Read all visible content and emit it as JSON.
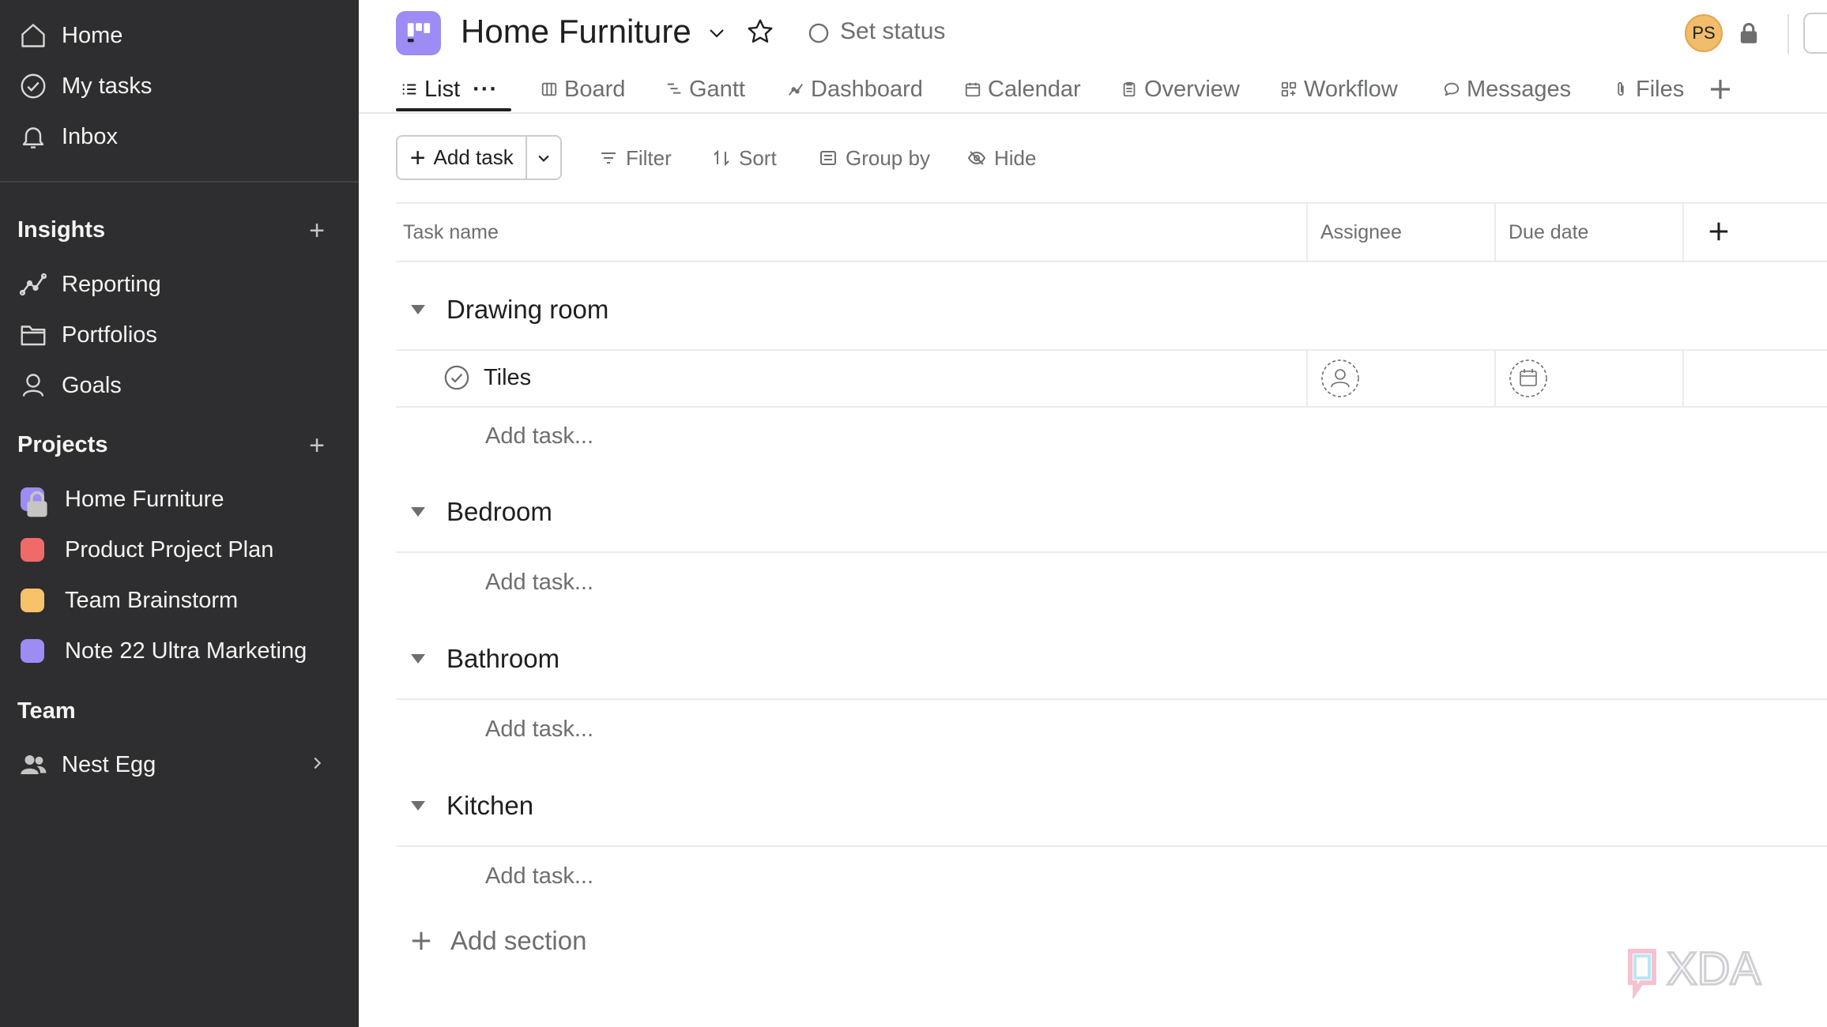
{
  "sidebar": {
    "nav": [
      {
        "label": "Home",
        "icon": "home-icon"
      },
      {
        "label": "My tasks",
        "icon": "check-circle-icon"
      },
      {
        "label": "Inbox",
        "icon": "bell-icon"
      }
    ],
    "insights": {
      "heading": "Insights",
      "items": [
        {
          "label": "Reporting",
          "icon": "reporting-icon"
        },
        {
          "label": "Portfolios",
          "icon": "folder-icon"
        },
        {
          "label": "Goals",
          "icon": "goals-icon"
        }
      ]
    },
    "projects": {
      "heading": "Projects",
      "items": [
        {
          "label": "Home Furniture",
          "color": "#9c8cf3"
        },
        {
          "label": "Product Project Plan",
          "color": "#f06a6a"
        },
        {
          "label": "Team Brainstorm",
          "color": "#f8c26a"
        },
        {
          "label": "Note 22 Ultra Marketing",
          "color": "#9c8cf3"
        }
      ]
    },
    "team": {
      "heading": "Team",
      "items": [
        {
          "label": "Nest Egg",
          "icon": "people-icon"
        }
      ]
    }
  },
  "header": {
    "project_title": "Home Furniture",
    "status_label": "Set status",
    "avatar_initials": "PS",
    "accent_color": "#9c8cf3"
  },
  "tabs": [
    {
      "label": "List",
      "icon": "list-icon",
      "active": true
    },
    {
      "label": "Board",
      "icon": "board-icon"
    },
    {
      "label": "Gantt",
      "icon": "gantt-icon"
    },
    {
      "label": "Dashboard",
      "icon": "dashboard-icon"
    },
    {
      "label": "Calendar",
      "icon": "calendar-icon"
    },
    {
      "label": "Overview",
      "icon": "overview-icon"
    },
    {
      "label": "Workflow",
      "icon": "workflow-icon"
    },
    {
      "label": "Messages",
      "icon": "message-icon"
    },
    {
      "label": "Files",
      "icon": "paperclip-icon"
    }
  ],
  "toolbar": {
    "add_task": "Add task",
    "filter": "Filter",
    "sort": "Sort",
    "group_by": "Group by",
    "hide": "Hide"
  },
  "table": {
    "columns": [
      "Task name",
      "Assignee",
      "Due date"
    ],
    "sections": [
      {
        "title": "Drawing room",
        "tasks": [
          "Tiles"
        ]
      },
      {
        "title": "Bedroom",
        "tasks": []
      },
      {
        "title": "Bathroom",
        "tasks": []
      },
      {
        "title": "Kitchen",
        "tasks": []
      }
    ],
    "add_task_placeholder": "Add task...",
    "add_section": "Add section"
  },
  "watermark": "XDA"
}
